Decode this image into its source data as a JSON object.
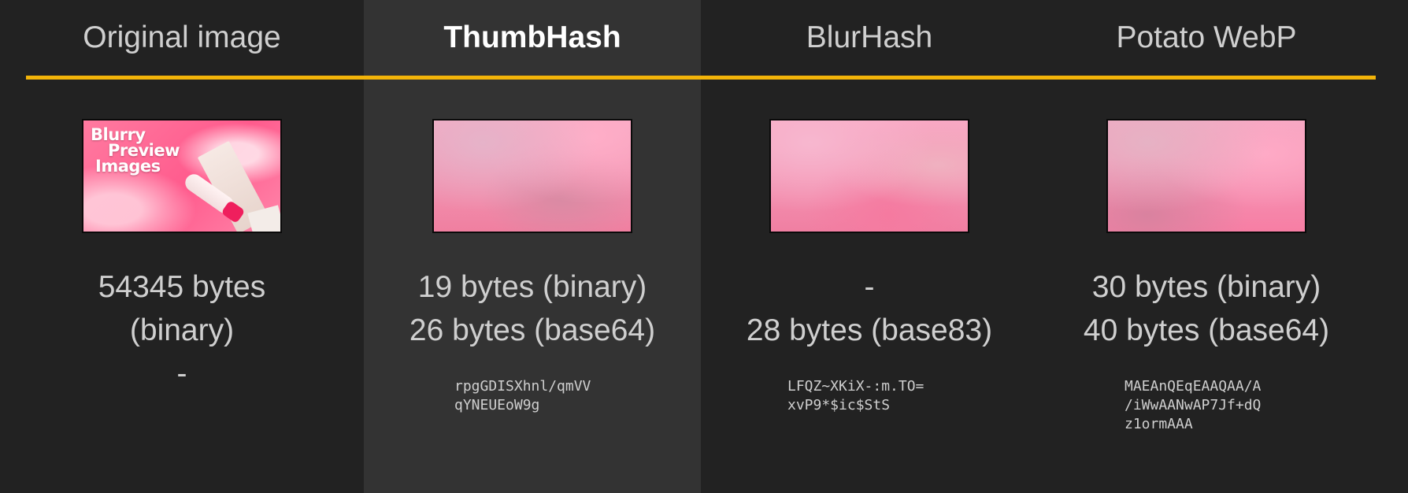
{
  "colors": {
    "background": "#222222",
    "highlight_column": "#333333",
    "accent_divider": "#f3b409"
  },
  "columns": [
    {
      "header": "Original image",
      "image": {
        "title_lines": [
          "Blurry",
          "Preview",
          "Images"
        ]
      },
      "bytes_line1": "54345 bytes",
      "bytes_line2": "(binary)",
      "bytes_line3": "-",
      "hash_lines": []
    },
    {
      "header": "ThumbHash",
      "bytes_line1": "19 bytes (binary)",
      "bytes_line2": "26 bytes (base64)",
      "hash_lines": [
        "rpgGDISXhnl/qmVV",
        "qYNEUEoW9g"
      ]
    },
    {
      "header": "BlurHash",
      "bytes_line1": "-",
      "bytes_line2": "28 bytes (base83)",
      "hash_lines": [
        "LFQZ~XKiX-:m.TO=",
        "xvP9*$ic$StS"
      ]
    },
    {
      "header": "Potato WebP",
      "bytes_line1": "30 bytes (binary)",
      "bytes_line2": "40 bytes (base64)",
      "hash_lines": [
        "MAEAnQEqEAAQAA/A",
        "/iWwAANwAP7Jf+dQ",
        "z1ormAAA"
      ]
    }
  ]
}
